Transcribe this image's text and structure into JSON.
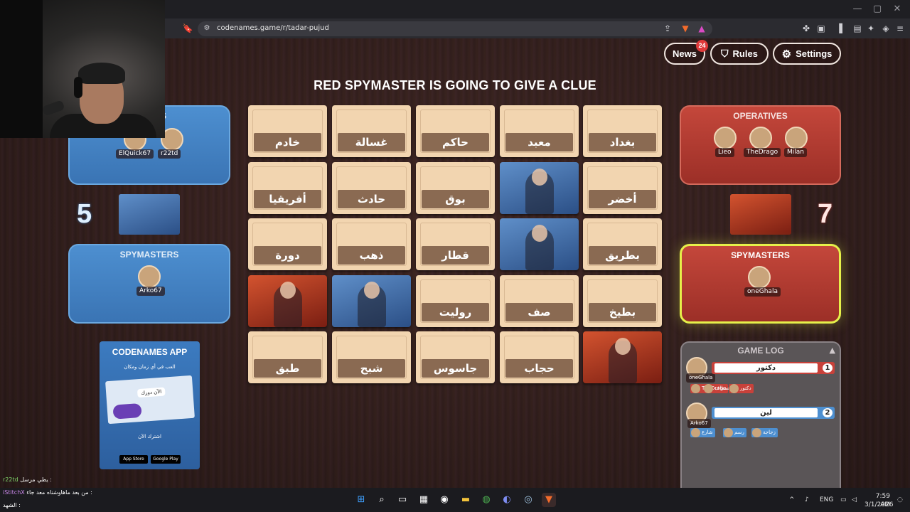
{
  "browser": {
    "url": "codenames.game/r/tadar-pujud",
    "window_controls": [
      "—",
      "▢",
      "✕"
    ]
  },
  "topbar": {
    "news_label": "News",
    "news_count": "24",
    "rules_label": "Rules",
    "settings_label": "Settings"
  },
  "status_message": "RED SPYMASTER IS GOING TO GIVE A CLUE",
  "cards": [
    {
      "word": "خادم",
      "state": "hidden"
    },
    {
      "word": "غسالة",
      "state": "hidden"
    },
    {
      "word": "حاكم",
      "state": "hidden"
    },
    {
      "word": "معبد",
      "state": "hidden"
    },
    {
      "word": "بغداد",
      "state": "hidden"
    },
    {
      "word": "أفريقيا",
      "state": "hidden"
    },
    {
      "word": "حادث",
      "state": "hidden"
    },
    {
      "word": "بوق",
      "state": "hidden"
    },
    {
      "word": "",
      "state": "blue"
    },
    {
      "word": "أخضر",
      "state": "hidden"
    },
    {
      "word": "دورة",
      "state": "hidden"
    },
    {
      "word": "ذهب",
      "state": "hidden"
    },
    {
      "word": "قطار",
      "state": "hidden"
    },
    {
      "word": "",
      "state": "blue"
    },
    {
      "word": "بطريق",
      "state": "hidden"
    },
    {
      "word": "",
      "state": "red"
    },
    {
      "word": "",
      "state": "blue"
    },
    {
      "word": "روليت",
      "state": "hidden"
    },
    {
      "word": "صف",
      "state": "hidden"
    },
    {
      "word": "بطيخ",
      "state": "hidden"
    },
    {
      "word": "طبق",
      "state": "hidden"
    },
    {
      "word": "شبح",
      "state": "hidden"
    },
    {
      "word": "جاسوس",
      "state": "hidden"
    },
    {
      "word": "حجاب",
      "state": "hidden"
    },
    {
      "word": "",
      "state": "red"
    }
  ],
  "blue_team": {
    "operatives_title_partial": "ES",
    "operatives": [
      "ElQuick67",
      "r22td"
    ],
    "score": "5",
    "spymasters_title": "SPYMASTERS",
    "spymasters": [
      "Arko67"
    ]
  },
  "red_team": {
    "operatives_title": "OPERATIVES",
    "operatives": [
      "Lieo",
      "TheDrago",
      "Milan"
    ],
    "score": "7",
    "spymasters_title": "SPYMASTERS",
    "spymasters": [
      "oneGhala"
    ]
  },
  "app_ad": {
    "title": "CODENAMES APP",
    "tagline": "العب في أي زمان ومكان",
    "bubble": "الآن دورك",
    "cta": "اشترك الآن",
    "store1": "App Store",
    "store2": "Google Play"
  },
  "game_log": {
    "title": "GAME LOG",
    "entries": [
      {
        "player": "oneGhala",
        "clue": "دكتور",
        "number": "1",
        "team": "red",
        "guesses": [
          {
            "player": "TheDrago",
            "word": "اصطاف"
          },
          {
            "player": "",
            "word": "دكتور"
          }
        ]
      },
      {
        "player": "Arko67",
        "clue": "لين",
        "number": "2",
        "team": "blue",
        "guesses": [
          {
            "player": "",
            "word": "شارع"
          },
          {
            "player": "",
            "word": "رسم"
          },
          {
            "player": "r22td",
            "word": "زجاجة"
          }
        ]
      }
    ]
  },
  "chat": [
    {
      "user": "r22td",
      "text": "يطي مرسل :",
      "color": "#7fd36a"
    },
    {
      "user": "iStitchX",
      "text": "من بعد ماهاوشناه معد جاء :",
      "color": "#c987e8"
    },
    {
      "user": "",
      "text": "الشهد :",
      "color": "#e05c5c"
    }
  ],
  "taskbar": {
    "lang": "ENG",
    "time": "7:59 AM",
    "date": "3/1/2026"
  },
  "colors": {
    "blue_team": "#4d8fd0",
    "red_team": "#c4473b",
    "card_tan": "#f2d5b0",
    "word_plate": "#8a6a52",
    "active_glow": "#e6f04a"
  }
}
